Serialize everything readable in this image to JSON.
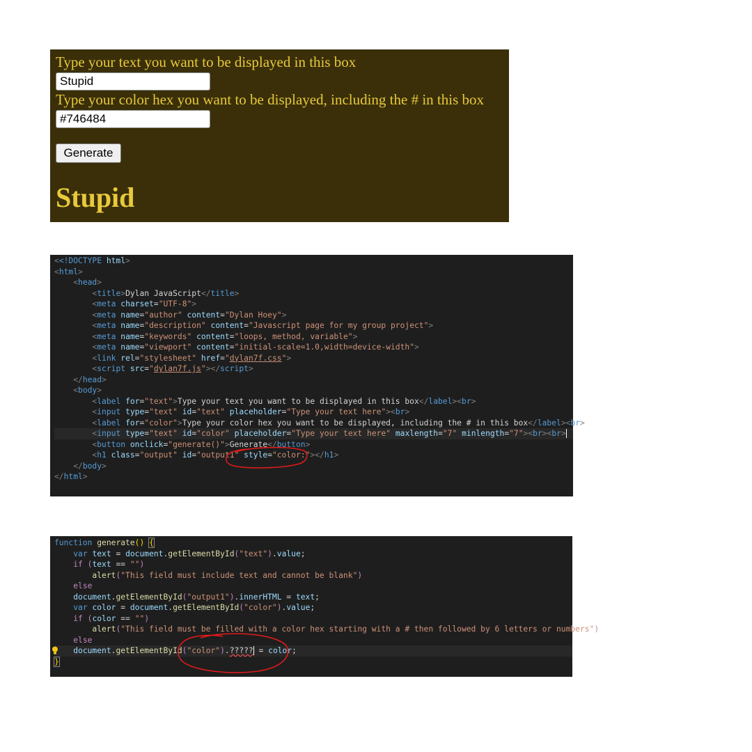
{
  "preview": {
    "text_label": "Type your text you want to be displayed in this box",
    "text_value": "Stupid",
    "color_label": "Type your color hex you want to be displayed, including the # in this box",
    "color_value": "#746484",
    "generate_label": "Generate",
    "output_text": "Stupid",
    "colors": {
      "background": "#3a2f09",
      "text": "#e8c93a"
    }
  },
  "html_code": {
    "l1_doctype": "<!DOCTYPE",
    "l1_html": " html",
    "l1_end": ">",
    "l2_html": "html",
    "l3_head": "head",
    "l4_title": "title",
    "l4_text": "Dylan JavaScript",
    "l5_meta": "meta",
    "l5_charset": "charset",
    "l5_val": "\"UTF-8\"",
    "l6_name": "name",
    "l6_author": "\"author\"",
    "l6_content": "content",
    "l6_val": "\"Dylan Hoey\"",
    "l7_desc": "\"description\"",
    "l7_val": "\"Javascript page for my group project\"",
    "l8_kw": "\"keywords\"",
    "l8_val": "\"loops, method, variable\"",
    "l9_vp": "\"viewport\"",
    "l9_val": "\"initial-scale=1.0,width=device-width\"",
    "l10_link": "link",
    "l10_rel": "rel",
    "l10_relv": "\"stylesheet\"",
    "l10_href": "href",
    "l10_hrefv": "dylan7f.css",
    "l11_script": "script",
    "l11_src": "src",
    "l11_srcv": "dylan7f.js",
    "l13_body": "body",
    "l14_label": "label",
    "l14_for": "for",
    "l14_forv": "\"text\"",
    "l14_text": "Type your text you want to be displayed in this box",
    "l14_br": "br",
    "l15_input": "input",
    "l15_type": "type",
    "l15_typev": "\"text\"",
    "l15_id": "id",
    "l15_idv": "\"text\"",
    "l15_ph": "placeholder",
    "l15_phv": "\"Type your text here\"",
    "l16_forv": "\"color\"",
    "l16_text": "Type your color hex you want to be displayed, including the # in this box",
    "l17_idv": "\"color\"",
    "l17_phv": "\"Type your text here\"",
    "l17_max": "maxlength",
    "l17_maxv": "\"7\"",
    "l17_min": "minlength",
    "l17_minv": "\"7\"",
    "l18_button": "button",
    "l18_onclick": "onclick",
    "l18_onclickv": "\"generate()\"",
    "l18_text": "Generate",
    "l19_h1": "h1",
    "l19_class": "class",
    "l19_classv": "\"output\"",
    "l19_idv": "\"output1\"",
    "l19_style": "style",
    "l19_stylev": "\"color:\""
  },
  "js_code": {
    "function": "function",
    "generate": "generate",
    "var": "var",
    "text": "text",
    "document": "document",
    "getById": "getElementById",
    "text_id": "\"text\"",
    "value": "value",
    "if": "if",
    "eq": "==",
    "empty": "\"\"",
    "alert": "alert",
    "msg1": "\"This field must include text and cannot be blank\"",
    "else": "else",
    "output_id": "\"output1\"",
    "innerHTML": "innerHTML",
    "color": "color",
    "color_id": "\"color\"",
    "msg2": "\"This field must be filled with a color hex starting with a # then followed by 6 letters or numbers\"",
    "unknown": "?????"
  }
}
